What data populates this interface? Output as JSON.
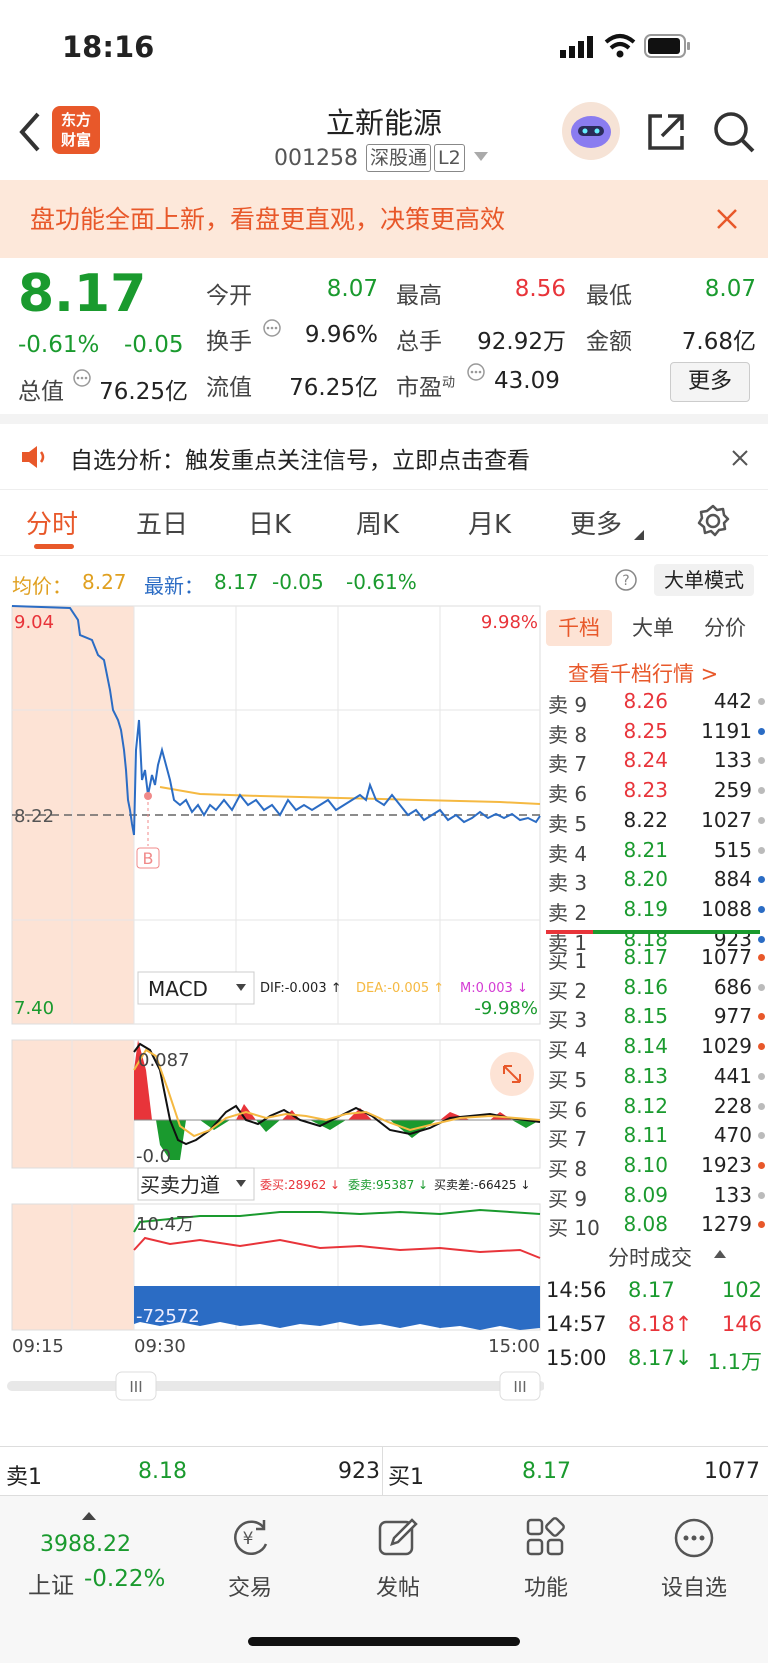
{
  "status_bar": {
    "time": "18:16"
  },
  "header": {
    "title": "立新能源",
    "code": "001258",
    "tag_connect": "深股通",
    "tag_level": "L2",
    "logo_line1": "东方",
    "logo_line2": "财富"
  },
  "banner": {
    "text": "盘功能全面上新，看盘更直观，决策更高效"
  },
  "quote": {
    "price": "8.17",
    "change_pct": "-0.61%",
    "change": "-0.05",
    "total_cap_label": "总值",
    "total_cap": "76.25亿",
    "open_label": "今开",
    "open": "8.07",
    "high_label": "最高",
    "high": "8.56",
    "low_label": "最低",
    "low": "8.07",
    "turnover_label": "换手",
    "turnover": "9.96%",
    "volume_label": "总手",
    "volume": "92.92万",
    "amount_label": "金额",
    "amount": "7.68亿",
    "float_cap_label": "流值",
    "float_cap": "76.25亿",
    "pe_label": "市盈",
    "pe_sup": "动",
    "pe": "43.09",
    "more_button": "更多"
  },
  "notice": {
    "text": "自选分析：触发重点关注信号，立即点击查看"
  },
  "tabs": [
    "分时",
    "五日",
    "日K",
    "周K",
    "月K",
    "更多"
  ],
  "info_line": {
    "avg_label": "均价：",
    "avg": "8.27",
    "latest_label": "最新：",
    "latest": "8.17",
    "change": "-0.05",
    "change_pct": "-0.61%",
    "big_order_button": "大单模式"
  },
  "chart": {
    "y_top": "9.04",
    "y_mid": "8.22",
    "y_bottom": "7.40",
    "pct_top": "9.98%",
    "pct_bottom": "-9.98%",
    "marker": "B",
    "macd_selector": "MACD",
    "dif": "DIF:-0.003 ↑",
    "dea": "DEA:-0.005 ↑",
    "m": "M:0.003 ↓",
    "macd_top": "0.087",
    "macd_bottom": "-0.0",
    "force_selector": "买卖力道",
    "buy_force": "委买:28962 ↓",
    "sell_force": "委卖:95387 ↓",
    "diff_force": "买卖差:-66425 ↓",
    "force_top": "10.4万",
    "force_bottom": "-72572",
    "time_start": "09:15",
    "time_open": "09:30",
    "time_end": "15:00",
    "slider_handle": "III"
  },
  "book_tabs": [
    "千档",
    "大单",
    "分价"
  ],
  "book_link": "查看千档行情 >",
  "asks": [
    {
      "label": "卖 9",
      "price": "8.26",
      "vol": "442",
      "color": "red",
      "dot": "#bbbbbb"
    },
    {
      "label": "卖 8",
      "price": "8.25",
      "vol": "1191",
      "color": "red",
      "dot": "#2b6cc4"
    },
    {
      "label": "卖 7",
      "price": "8.24",
      "vol": "133",
      "color": "red",
      "dot": "#bbbbbb"
    },
    {
      "label": "卖 6",
      "price": "8.23",
      "vol": "259",
      "color": "red",
      "dot": "#bbbbbb"
    },
    {
      "label": "卖 5",
      "price": "8.22",
      "vol": "1027",
      "color": "black",
      "dot": "#bbbbbb"
    },
    {
      "label": "卖 4",
      "price": "8.21",
      "vol": "515",
      "color": "green",
      "dot": "#bbbbbb"
    },
    {
      "label": "卖 3",
      "price": "8.20",
      "vol": "884",
      "color": "green",
      "dot": "#2b6cc4"
    },
    {
      "label": "卖 2",
      "price": "8.19",
      "vol": "1088",
      "color": "green",
      "dot": "#2b6cc4"
    },
    {
      "label": "卖 1",
      "price": "8.18",
      "vol": "923",
      "color": "green",
      "dot": "#2b6cc4"
    }
  ],
  "bids": [
    {
      "label": "买 1",
      "price": "8.17",
      "vol": "1077",
      "color": "green",
      "dot": "#e8582a"
    },
    {
      "label": "买 2",
      "price": "8.16",
      "vol": "686",
      "color": "green",
      "dot": "#bbbbbb"
    },
    {
      "label": "买 3",
      "price": "8.15",
      "vol": "977",
      "color": "green",
      "dot": "#e8582a"
    },
    {
      "label": "买 4",
      "price": "8.14",
      "vol": "1029",
      "color": "green",
      "dot": "#e8582a"
    },
    {
      "label": "买 5",
      "price": "8.13",
      "vol": "441",
      "color": "green",
      "dot": "#bbbbbb"
    },
    {
      "label": "买 6",
      "price": "8.12",
      "vol": "228",
      "color": "green",
      "dot": "#bbbbbb"
    },
    {
      "label": "买 7",
      "price": "8.11",
      "vol": "470",
      "color": "green",
      "dot": "#bbbbbb"
    },
    {
      "label": "买 8",
      "price": "8.10",
      "vol": "1923",
      "color": "green",
      "dot": "#e8582a"
    },
    {
      "label": "买 9",
      "price": "8.09",
      "vol": "133",
      "color": "green",
      "dot": "#bbbbbb"
    },
    {
      "label": "买 10",
      "price": "8.08",
      "vol": "1279",
      "color": "green",
      "dot": "#e8582a"
    }
  ],
  "trades_title": "分时成交",
  "trades": [
    {
      "time": "14:56",
      "price": "8.17",
      "vol": "102",
      "pcolor": "green",
      "vcolor": "green"
    },
    {
      "time": "14:57",
      "price": "8.18↑",
      "vol": "146",
      "pcolor": "red",
      "vcolor": "red"
    },
    {
      "time": "15:00",
      "price": "8.17↓",
      "vol": "1.1万",
      "pcolor": "green",
      "vcolor": "green"
    }
  ],
  "summary": {
    "ask_label": "卖1",
    "ask_price": "8.18",
    "ask_vol": "923",
    "bid_label": "买1",
    "bid_price": "8.17",
    "bid_vol": "1077"
  },
  "bottom_nav": {
    "index_value": "3988.22",
    "index_name": "上证",
    "index_change": "-0.22%",
    "trade": "交易",
    "post": "发帖",
    "functions": "功能",
    "watchlist": "设自选"
  },
  "colors": {
    "up": "#e8343a",
    "down": "#1a9a2e",
    "accent": "#e8582a",
    "line": "#2b6cc4",
    "avg": "#f5b942"
  }
}
